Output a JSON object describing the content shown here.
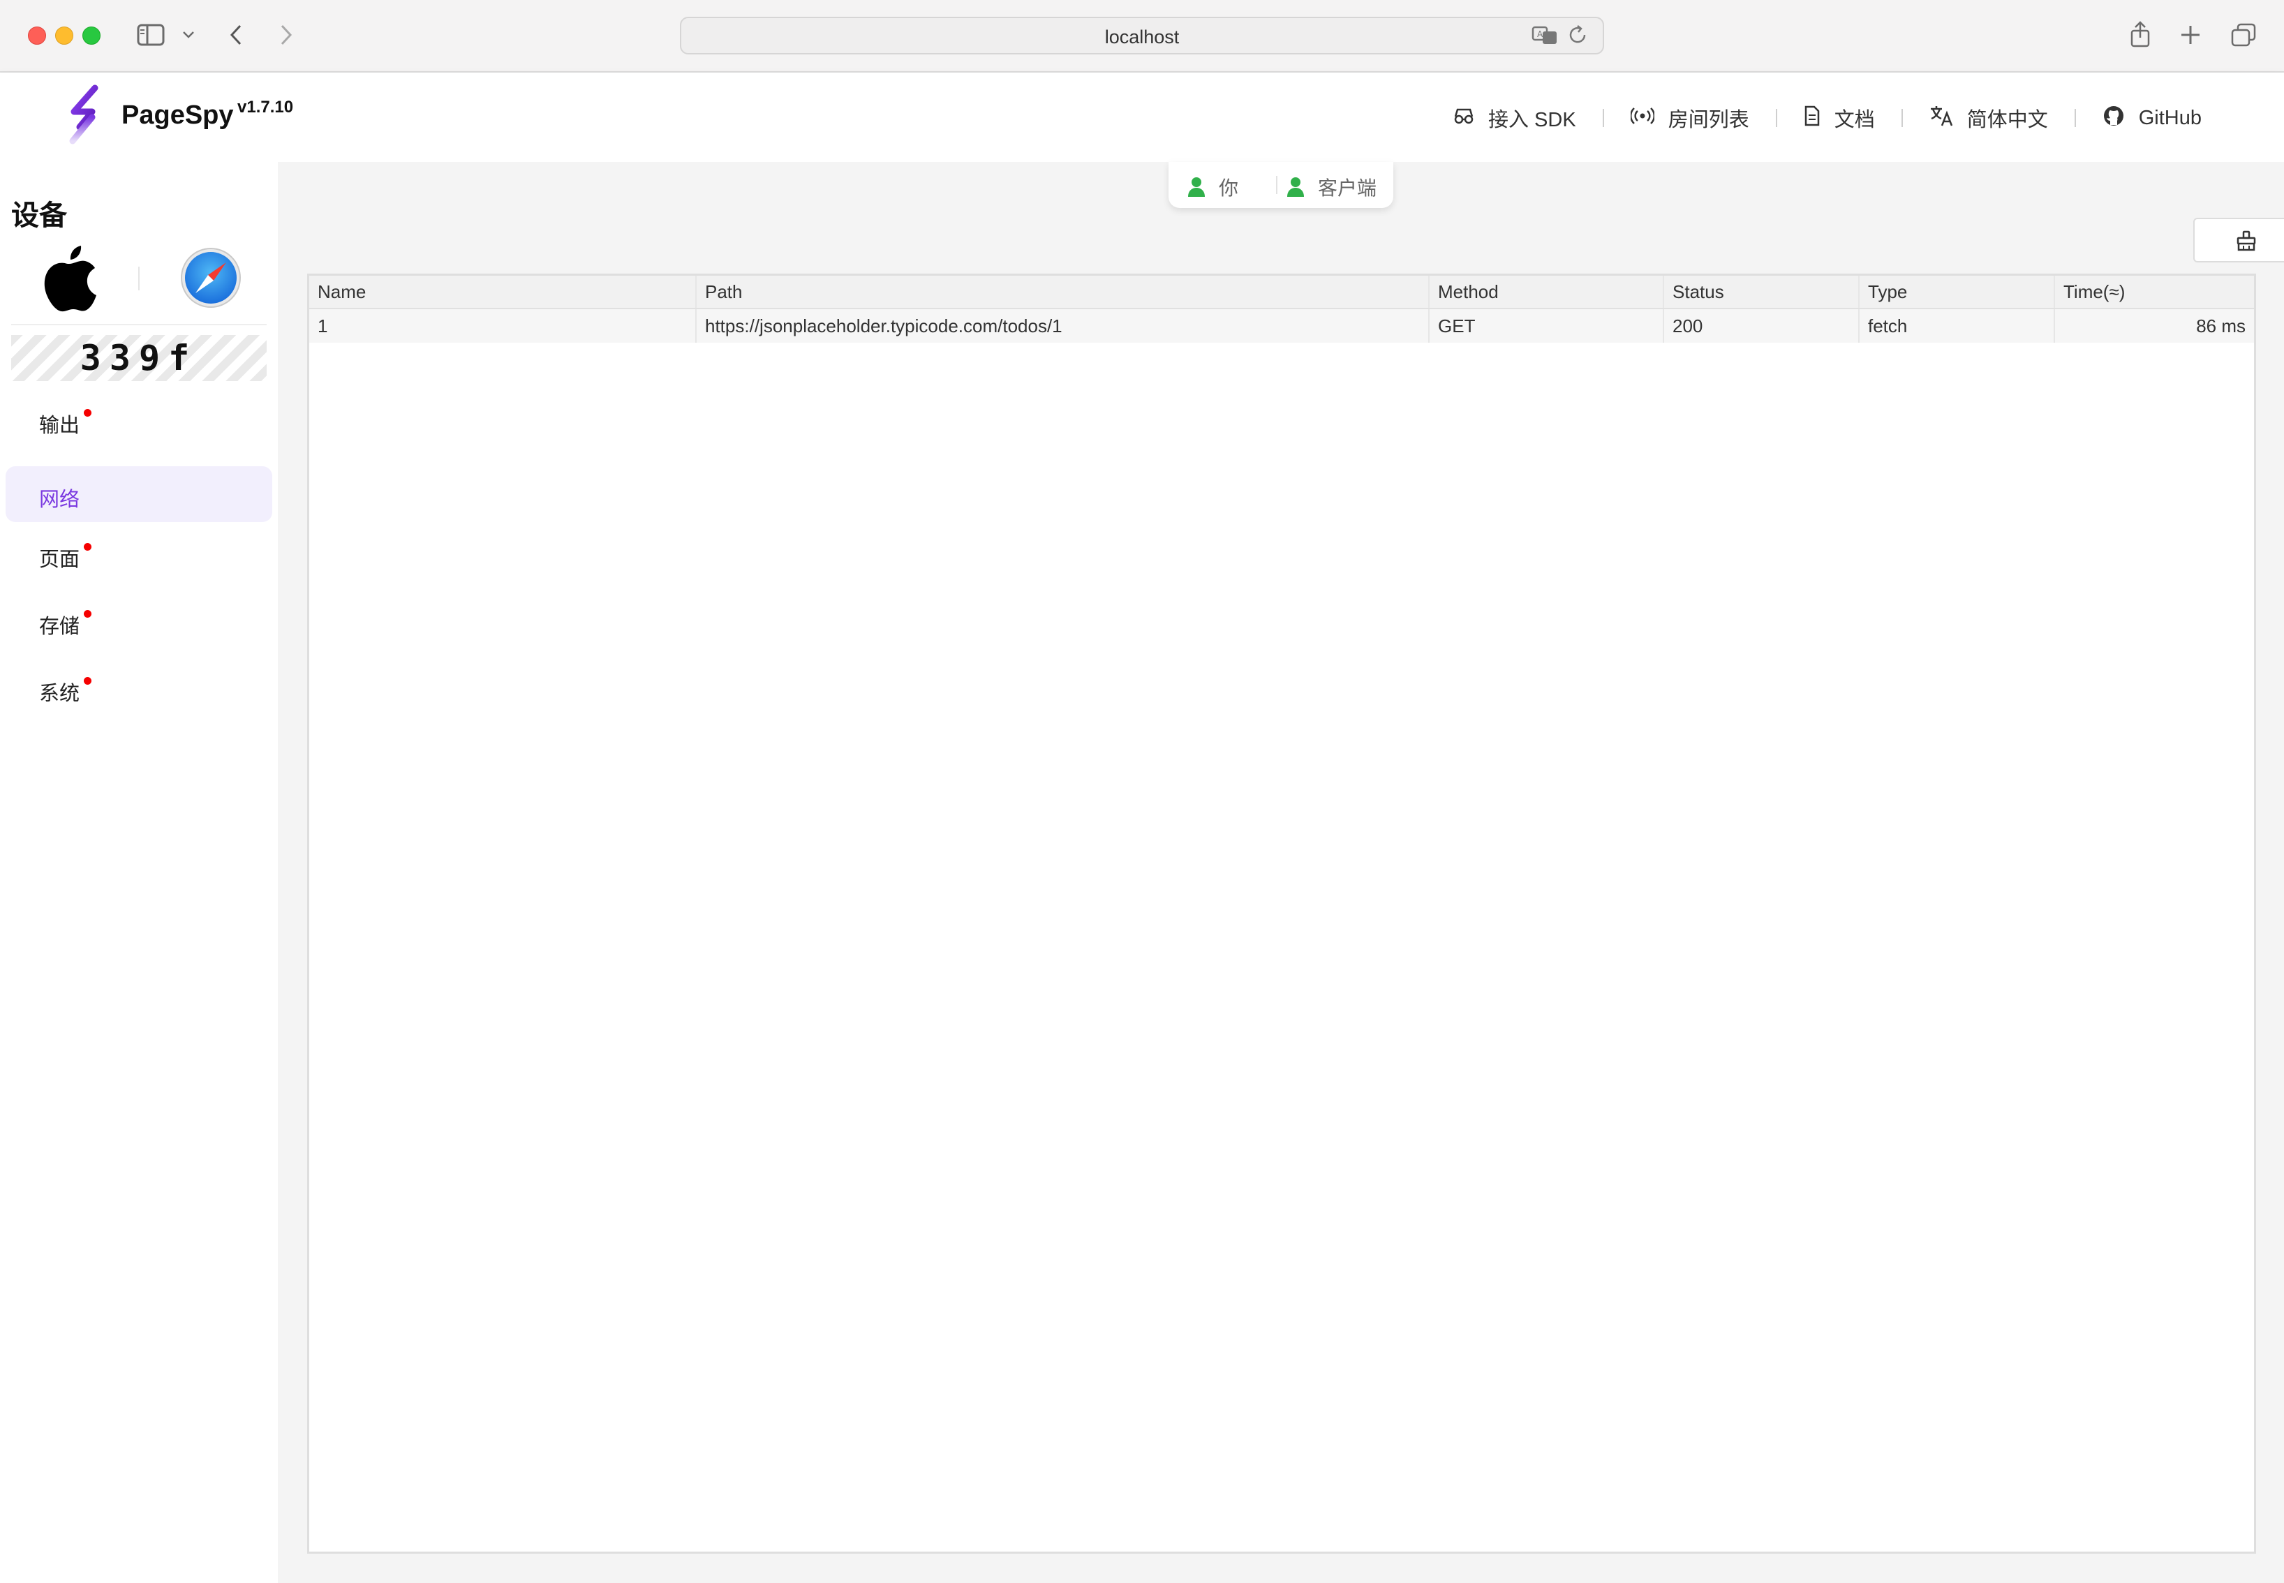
{
  "browser": {
    "url": "localhost"
  },
  "app": {
    "brand": "PageSpy",
    "version": "v1.7.10",
    "nav": [
      {
        "label": "接入 SDK",
        "icon": "sdk-icon"
      },
      {
        "label": "房间列表",
        "icon": "broadcast-icon"
      },
      {
        "label": "文档",
        "icon": "document-icon"
      },
      {
        "label": "简体中文",
        "icon": "translate-icon"
      },
      {
        "label": "GitHub",
        "icon": "github-icon"
      }
    ]
  },
  "sidebar": {
    "title": "设备",
    "device_id": "339f",
    "menu": [
      {
        "label": "输出",
        "has_dot": true,
        "active": false
      },
      {
        "label": "网络",
        "has_dot": false,
        "active": true
      },
      {
        "label": "页面",
        "has_dot": true,
        "active": false
      },
      {
        "label": "存储",
        "has_dot": true,
        "active": false
      },
      {
        "label": "系统",
        "has_dot": true,
        "active": false
      }
    ]
  },
  "connection": {
    "you": "你",
    "client": "客户端",
    "status_color": "#30b04a"
  },
  "network_table": {
    "columns": [
      "Name",
      "Path",
      "Method",
      "Status",
      "Type",
      "Time(≈)"
    ],
    "rows": [
      {
        "name": "1",
        "path": "https://jsonplaceholder.typicode.com/todos/1",
        "method": "GET",
        "status": "200",
        "type": "fetch",
        "time": "86 ms"
      }
    ]
  },
  "colors": {
    "accent": "#7a38e0",
    "badge_dot": "#f50000"
  }
}
